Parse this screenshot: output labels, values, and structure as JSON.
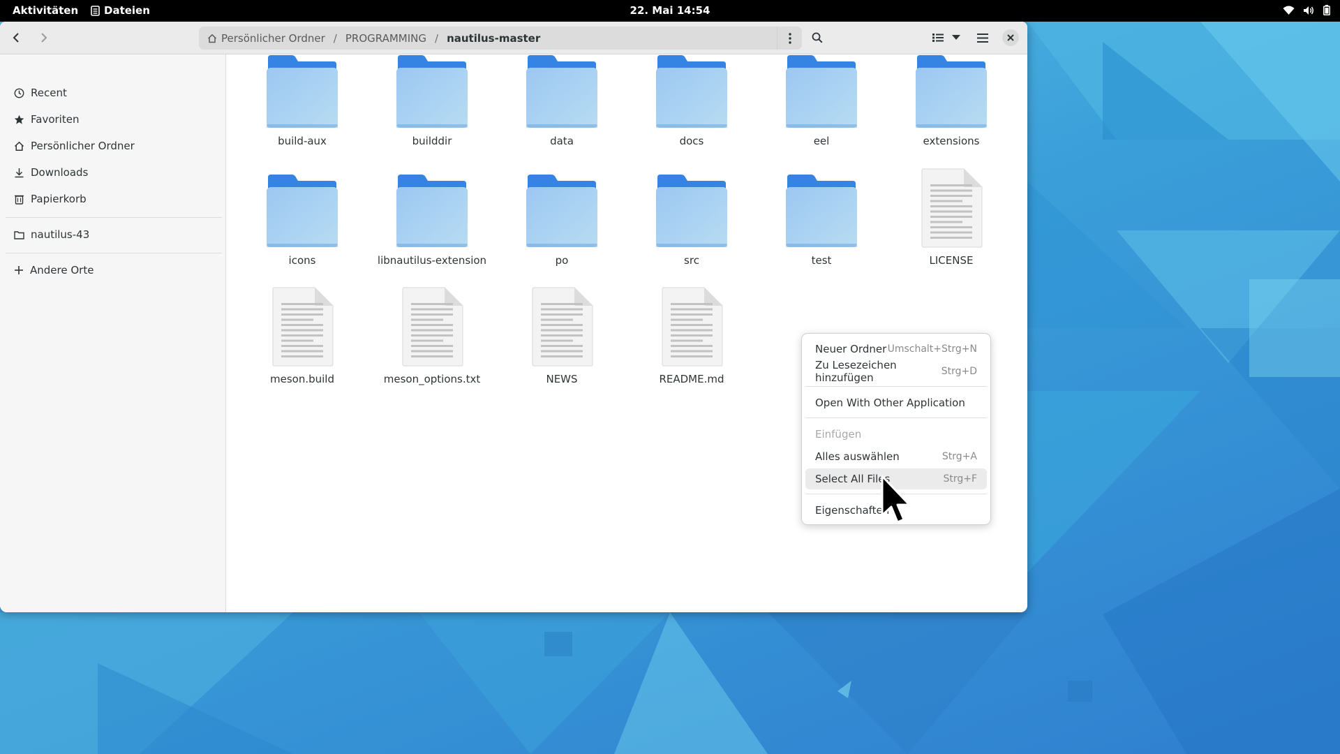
{
  "topbar": {
    "activities": "Aktivitäten",
    "app_name": "Dateien",
    "clock": "22. Mai  14:54",
    "status_icons": [
      "wifi-icon",
      "volume-icon",
      "battery-icon"
    ]
  },
  "window": {
    "nav": {
      "back": "back-arrow-icon",
      "forward": "forward-arrow-icon"
    },
    "path": {
      "home": "Persönlicher Ordner",
      "folder": "PROGRAMMING",
      "current": "nautilus-master",
      "separator": "/"
    },
    "toolbar_icons": [
      "search-icon",
      "list-view-icon",
      "view-options-chevron-icon",
      "hamburger-menu-icon",
      "close-icon"
    ]
  },
  "sidebar": {
    "items": [
      {
        "label": "Recent",
        "icon": "recent-clock-icon"
      },
      {
        "label": "Favoriten",
        "icon": "star-icon"
      },
      {
        "label": "Persönlicher Ordner",
        "icon": "home-icon"
      },
      {
        "label": "Downloads",
        "icon": "download-icon"
      },
      {
        "label": "Papierkorb",
        "icon": "trash-icon"
      }
    ],
    "bookmarks": [
      {
        "label": "nautilus-43",
        "icon": "folder-icon"
      }
    ],
    "other": {
      "label": "Andere Orte",
      "icon": "plus-icon"
    }
  },
  "files": [
    {
      "name": "build-aux",
      "kind": "folder"
    },
    {
      "name": "builddir",
      "kind": "folder"
    },
    {
      "name": "data",
      "kind": "folder"
    },
    {
      "name": "docs",
      "kind": "folder"
    },
    {
      "name": "eel",
      "kind": "folder"
    },
    {
      "name": "extensions",
      "kind": "folder"
    },
    {
      "name": "icons",
      "kind": "folder"
    },
    {
      "name": "libnautilus-extension",
      "kind": "folder"
    },
    {
      "name": "po",
      "kind": "folder"
    },
    {
      "name": "src",
      "kind": "folder"
    },
    {
      "name": "test",
      "kind": "folder"
    },
    {
      "name": "LICENSE",
      "kind": "file"
    },
    {
      "name": "meson.build",
      "kind": "file"
    },
    {
      "name": "meson_options.txt",
      "kind": "file"
    },
    {
      "name": "NEWS",
      "kind": "file"
    },
    {
      "name": "README.md",
      "kind": "file"
    }
  ],
  "context_menu": {
    "items": [
      {
        "label": "Neuer Ordner",
        "accel": "Umschalt+Strg+N"
      },
      {
        "label": "Zu Lesezeichen hinzufügen",
        "accel": "Strg+D"
      },
      {
        "label": "Open With Other Application",
        "accel": ""
      },
      {
        "label": "Einfügen",
        "accel": "",
        "disabled": true
      },
      {
        "label": "Alles auswählen",
        "accel": "Strg+A"
      },
      {
        "label": "Select All Files",
        "accel": "Strg+F",
        "hovered": true
      },
      {
        "label": "Eigenschaften",
        "accel": ""
      }
    ]
  },
  "colors": {
    "folder_top": "#3584e4",
    "folder_body": "#8fbfef",
    "accent": "#3584e4"
  }
}
